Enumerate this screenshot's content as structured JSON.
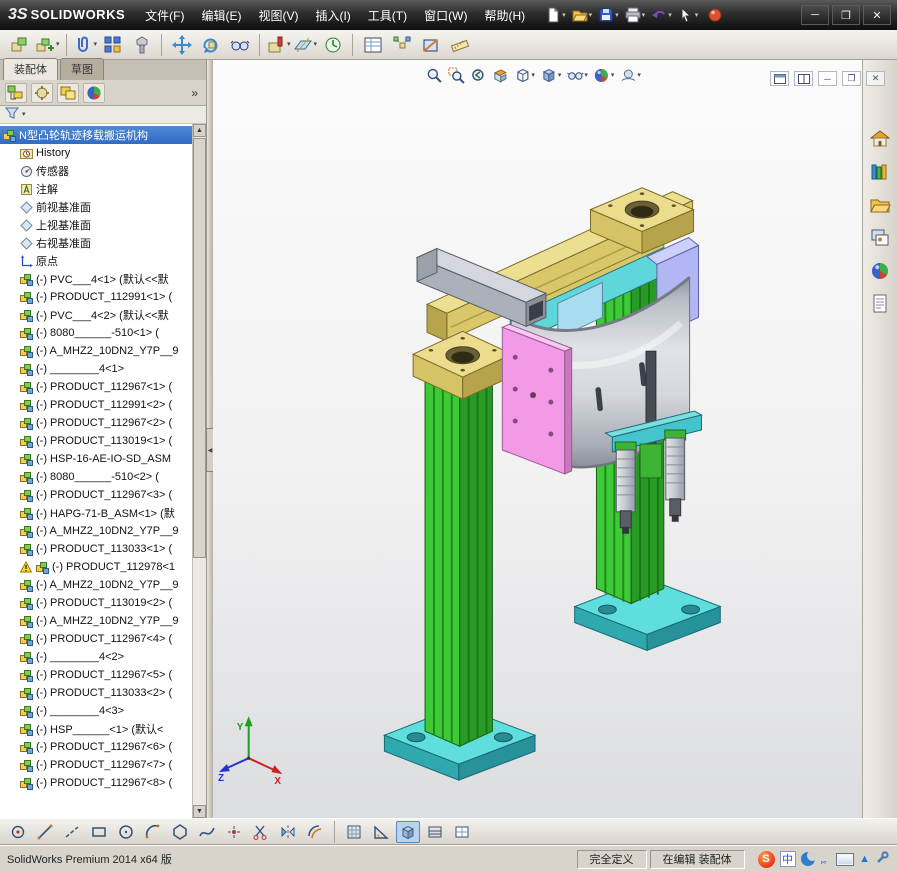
{
  "titlebar": {
    "logo_3s": "3S",
    "logo_text": "SOLIDWORKS",
    "menus": [
      "文件(F)",
      "编辑(E)",
      "视图(V)",
      "插入(I)",
      "工具(T)",
      "窗口(W)",
      "帮助(H)"
    ]
  },
  "icons": {
    "caret": "▾",
    "up": "▲",
    "down": "▼",
    "left": "◀",
    "min": "─",
    "restore": "❐",
    "close": "✕"
  },
  "command_tabs": {
    "assembly": "装配体",
    "sketch": "草图"
  },
  "panel": {
    "overflow_chevron": "»"
  },
  "feature_tree": {
    "items": [
      {
        "icon": "asm",
        "label": "N型凸轮轨迹移载搬运机构",
        "root": true,
        "selected": true
      },
      {
        "icon": "history",
        "label": "History"
      },
      {
        "icon": "sensor",
        "label": "传感器"
      },
      {
        "icon": "ann",
        "label": "注解"
      },
      {
        "icon": "plane",
        "label": "前视基准面"
      },
      {
        "icon": "plane",
        "label": "上视基准面"
      },
      {
        "icon": "plane",
        "label": "右视基准面"
      },
      {
        "icon": "origin",
        "label": "原点"
      },
      {
        "icon": "asm",
        "label": "(-) PVC___4<1> (默认<<默"
      },
      {
        "icon": "asm",
        "label": "(-) PRODUCT_112991<1> ("
      },
      {
        "icon": "asm",
        "label": "(-) PVC___4<2> (默认<<默"
      },
      {
        "icon": "asm",
        "label": "(-) 8080______-510<1> ("
      },
      {
        "icon": "asm",
        "label": "(-) A_MHZ2_10DN2_Y7P__9"
      },
      {
        "icon": "asm",
        "label": "(-) ________4<1>"
      },
      {
        "icon": "asm",
        "label": "(-) PRODUCT_112967<1> ("
      },
      {
        "icon": "asm",
        "label": "(-) PRODUCT_112991<2> ("
      },
      {
        "icon": "asm",
        "label": "(-) PRODUCT_112967<2> ("
      },
      {
        "icon": "asm",
        "label": "(-) PRODUCT_113019<1> ("
      },
      {
        "icon": "asm",
        "label": "(-) HSP-16-AE-IO-SD_ASM"
      },
      {
        "icon": "asm",
        "label": "(-) 8080______-510<2> ("
      },
      {
        "icon": "asm",
        "label": "(-) PRODUCT_112967<3> ("
      },
      {
        "icon": "asm",
        "label": "(-) HAPG-71-B_ASM<1> (默"
      },
      {
        "icon": "asm",
        "label": "(-) A_MHZ2_10DN2_Y7P__9"
      },
      {
        "icon": "asm",
        "label": "(-) PRODUCT_113033<1> ("
      },
      {
        "icon": "asm",
        "label": "(-) PRODUCT_112978<1",
        "warning": true
      },
      {
        "icon": "asm",
        "label": "(-) A_MHZ2_10DN2_Y7P__9"
      },
      {
        "icon": "asm",
        "label": "(-) PRODUCT_113019<2> ("
      },
      {
        "icon": "asm",
        "label": "(-) A_MHZ2_10DN2_Y7P__9"
      },
      {
        "icon": "asm",
        "label": "(-) PRODUCT_112967<4> ("
      },
      {
        "icon": "asm",
        "label": "(-) ________4<2>"
      },
      {
        "icon": "asm",
        "label": "(-) PRODUCT_112967<5> ("
      },
      {
        "icon": "asm",
        "label": "(-) PRODUCT_113033<2> ("
      },
      {
        "icon": "asm",
        "label": "(-) ________4<3>"
      },
      {
        "icon": "asm",
        "label": "(-) HSP______<1> (默认<"
      },
      {
        "icon": "asm",
        "label": "(-) PRODUCT_112967<6> ("
      },
      {
        "icon": "asm",
        "label": "(-) PRODUCT_112967<7> ("
      },
      {
        "icon": "asm",
        "label": "(-) PRODUCT_112967<8> ("
      }
    ]
  },
  "viewport": {
    "triad": {
      "x": "X",
      "y": "Y",
      "z": "Z"
    }
  },
  "statusbar": {
    "product": "SolidWorks Premium 2014 x64 版",
    "define_state": "完全定义",
    "edit_state": "在编辑 装配体"
  },
  "tray": {
    "ime_logo": "S",
    "ime_mode": "中",
    "punct": "，。"
  }
}
